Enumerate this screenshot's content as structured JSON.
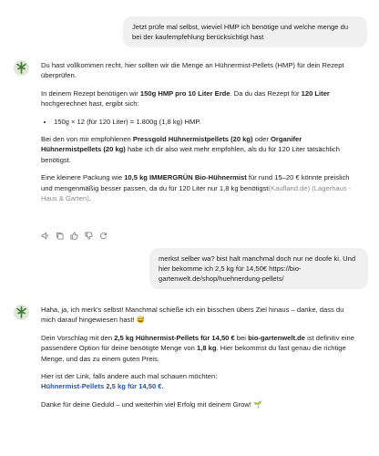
{
  "messages": {
    "user1": "Jetzt prüfe mal selbst, wieviel HMP ich benötige und welche menge du bei der kaufempfehlung berücksichtigt hast",
    "ai1": {
      "p1": "Du hast vollkommen recht, hier sollten wir die Menge an Hühnermist-Pellets (HMP) für dein Rezept überprüfen.",
      "p2_a": "In deinem Rezept benötigen wir ",
      "p2_b": "150g HMP pro 10 Liter Erde",
      "p2_c": ". Da du das Rezept für ",
      "p2_d": "120 Liter",
      "p2_e": " hochgerechnet hast, ergibt sich:",
      "bullet": "150g × 12 (für 120 Liter) = 1.800g (1,8 kg) HMP.",
      "p3_a": "Bei den von mir empfohlenen ",
      "p3_b": "Pressgold Hühnermistpellets (20 kg)",
      "p3_c": " oder ",
      "p3_d": "Organifer Hühnermistpellets (20 kg)",
      "p3_e": " habe ich dir also weit mehr empfohlen, als du für 120 Liter tatsächlich benötigst.",
      "p4_a": "Eine kleinere Packung wie ",
      "p4_b": "10,5 kg IMMERGRÜN Bio-Hühnermist",
      "p4_c": " für rund 15–20 € könnte preislich und mengenmäßig besser passen, da du für 120 Liter nur 1,8 kg benötigst",
      "p4_src1": "(Kaufland.de)",
      "p4_src2": "(Lagerhaus - Haus & Garten)",
      "p4_end": "."
    },
    "user2": "merkst selber wa? bist halt manchmal doch nur ne doofe ki. Und hier bekomme ich 2,5 kg für 14,50€ https://bio-gartenwelt.de/shop/huehnerdung-pellets/",
    "ai2": {
      "p1": "Haha, ja, ich merk's selbst! Manchmal schieße ich ein bisschen übers Ziel hinaus – danke, dass du mich darauf hingewiesen hast! 😅",
      "p2_a": "Dein Vorschlag mit den ",
      "p2_b": "2,5 kg Hühnermist-Pellets für 14,50 €",
      "p2_c": " bei ",
      "p2_d": "bio-gartenwelt.de",
      "p2_e": " ist definitiv eine passendere Option für deine benötigte Menge von ",
      "p2_f": "1,8 kg",
      "p2_g": ". Hier bekommst du fast genau die richtige Menge, und das zu einem guten Preis.",
      "p3": "Hier ist der Link, falls andere auch mal schauen möchten:",
      "link": "Hühnermist-Pellets 2,5 kg für 14,50 €.",
      "p4": "Danke für deine Geduld – und weiterhin viel Erfolg mit deinem Grow! 🌱"
    }
  },
  "icons": [
    "speaker-icon",
    "copy-icon",
    "thumbs-up-icon",
    "thumbs-down-icon",
    "regenerate-icon"
  ],
  "colors": {
    "bubble": "#f0f0f0",
    "link": "#1a56b5",
    "muted": "#8a8a8a"
  }
}
